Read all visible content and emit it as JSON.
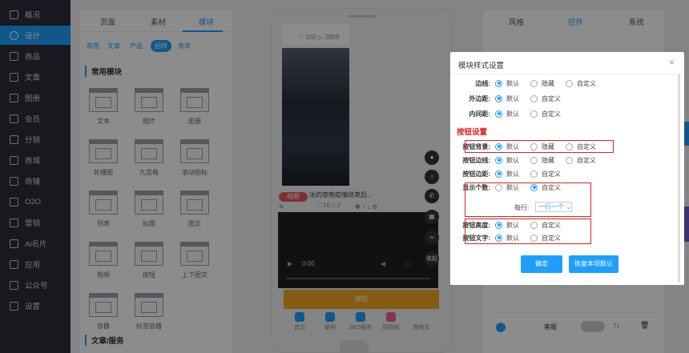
{
  "sidebar": {
    "items": [
      {
        "label": "概况",
        "icon": "chart-icon"
      },
      {
        "label": "设计",
        "icon": "design-icon",
        "active": true
      },
      {
        "label": "商品",
        "icon": "cube-icon"
      },
      {
        "label": "文章",
        "icon": "article-icon"
      },
      {
        "label": "图册",
        "icon": "image-icon"
      },
      {
        "label": "会员",
        "icon": "user-icon"
      },
      {
        "label": "分销",
        "icon": "network-icon"
      },
      {
        "label": "商城",
        "icon": "doc-icon"
      },
      {
        "label": "商铺",
        "icon": "shop-icon"
      },
      {
        "label": "O2O",
        "icon": "store-icon"
      },
      {
        "label": "营销",
        "icon": "chart-icon"
      },
      {
        "label": "Ai名片",
        "icon": "card-icon"
      },
      {
        "label": "应用",
        "icon": "grid-icon"
      },
      {
        "label": "公众号",
        "icon": "card-icon"
      },
      {
        "label": "设置",
        "icon": "gear-icon"
      }
    ]
  },
  "module_panel": {
    "tabs": [
      "页面",
      "素材",
      "模块"
    ],
    "filters": [
      "常用",
      "文章",
      "产品",
      "招样",
      "表单"
    ],
    "section1": "常用模块",
    "modules": [
      {
        "label": "文本"
      },
      {
        "label": "图片"
      },
      {
        "label": "图册"
      },
      {
        "label": "轮播图"
      },
      {
        "label": "九宫格"
      },
      {
        "label": "滚动图标"
      },
      {
        "label": "列表"
      },
      {
        "label": "标题"
      },
      {
        "label": "图文"
      },
      {
        "label": "视频"
      },
      {
        "label": "按钮"
      },
      {
        "label": "上下图文"
      },
      {
        "label": "容器"
      },
      {
        "label": "标签容器"
      }
    ],
    "section2": "文章/服务"
  },
  "phone": {
    "stats": {
      "likes": "150",
      "views": "2809"
    },
    "post_title": "冰的夜晚疫情结束后...",
    "tag": "视频",
    "stats2": {
      "likes": "16",
      "views": "2"
    },
    "video_time": "0:00",
    "button_label": "按钮",
    "collapse_label": "收起",
    "tabbar": [
      "首页",
      "案例",
      "SEO服务",
      "短视频",
      "购物车"
    ]
  },
  "right_panel": {
    "tabs": [
      "风格",
      "控件",
      "系统"
    ],
    "bottom_label": "客服"
  },
  "modal": {
    "title": "模块样式设置",
    "close": "×",
    "rows_top": [
      {
        "label": "边线:",
        "options": [
          "默认",
          "隐藏",
          "自定义"
        ],
        "selected": 0
      },
      {
        "label": "外边距:",
        "options": [
          "默认",
          "自定义"
        ],
        "selected": 0
      },
      {
        "label": "内间距:",
        "options": [
          "默认",
          "自定义"
        ],
        "selected": 0
      }
    ],
    "section": "按钮设置",
    "rows_btn": [
      {
        "label": "按钮背景:",
        "options": [
          "默认",
          "隐藏",
          "自定义"
        ],
        "selected": 0
      },
      {
        "label": "按钮边线:",
        "options": [
          "默认",
          "隐藏",
          "自定义"
        ],
        "selected": 0
      },
      {
        "label": "按钮边距:",
        "options": [
          "默认",
          "自定义"
        ],
        "selected": 0
      },
      {
        "label": "显示个数:",
        "options": [
          "默认",
          "自定义"
        ],
        "selected": 1
      }
    ],
    "per_row_label": "每行:",
    "per_row_value": "一行一个",
    "rows_btn2": [
      {
        "label": "按钮高度:",
        "options": [
          "默认",
          "自定义"
        ],
        "selected": 0
      },
      {
        "label": "按钮文字:",
        "options": [
          "默认",
          "自定义"
        ],
        "selected": 0
      }
    ],
    "confirm": "确定",
    "reset": "恢复本项默认"
  }
}
